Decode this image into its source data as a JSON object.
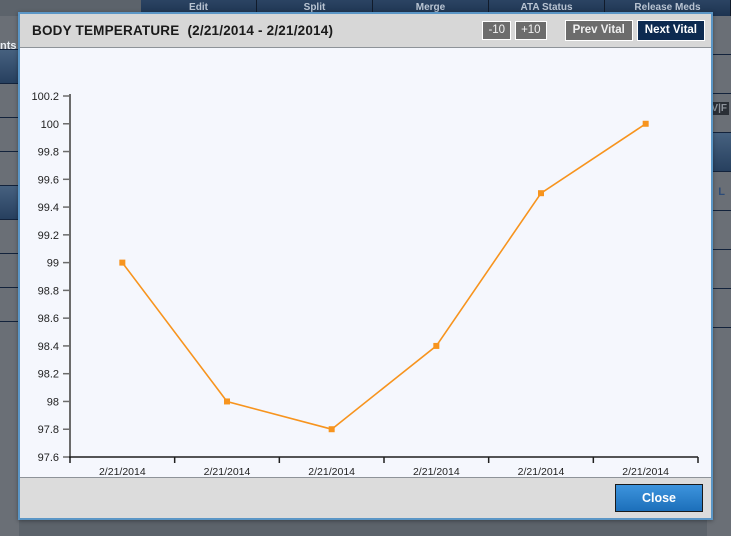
{
  "background": {
    "menu_items": [
      "Edit",
      "Split",
      "Merge",
      "ATA Status",
      "Release Meds"
    ],
    "left_tab_label": "nts",
    "right_glyph": "V|F",
    "right_glyph2": "L"
  },
  "modal": {
    "title": "BODY TEMPERATURE",
    "date_range": "(2/21/2014 - 2/21/2014)",
    "buttons": {
      "step_down": "-10",
      "step_up": "+10",
      "prev_vital": "Prev Vital",
      "next_vital": "Next Vital",
      "close": "Close"
    }
  },
  "chart_data": {
    "type": "line",
    "title": "BODY TEMPERATURE",
    "categories": [
      "2/21/2014",
      "2/21/2014",
      "2/21/2014",
      "2/21/2014",
      "2/21/2014",
      "2/21/2014"
    ],
    "series": [
      {
        "name": "BODY TEMPERATURE",
        "color": "#f7941e",
        "values": [
          99,
          98,
          97.8,
          98.4,
          99.5,
          100
        ]
      }
    ],
    "xlabel": "",
    "ylabel": "",
    "ylim": [
      97.6,
      100.2
    ],
    "ytick_step": 0.2,
    "yticks": [
      "97.6",
      "97.8",
      "98",
      "98.2",
      "98.4",
      "98.6",
      "98.8",
      "99",
      "99.2",
      "99.4",
      "99.6",
      "99.8",
      "100",
      "100.2"
    ],
    "grid": false,
    "legend": [
      {
        "label": "BODY TEMPERATURE",
        "color": "#f7941e"
      }
    ],
    "legend_position": "bottom",
    "marker": "square",
    "plot_background": "#f5f7fd",
    "axis_color": "#6b6b6b"
  }
}
